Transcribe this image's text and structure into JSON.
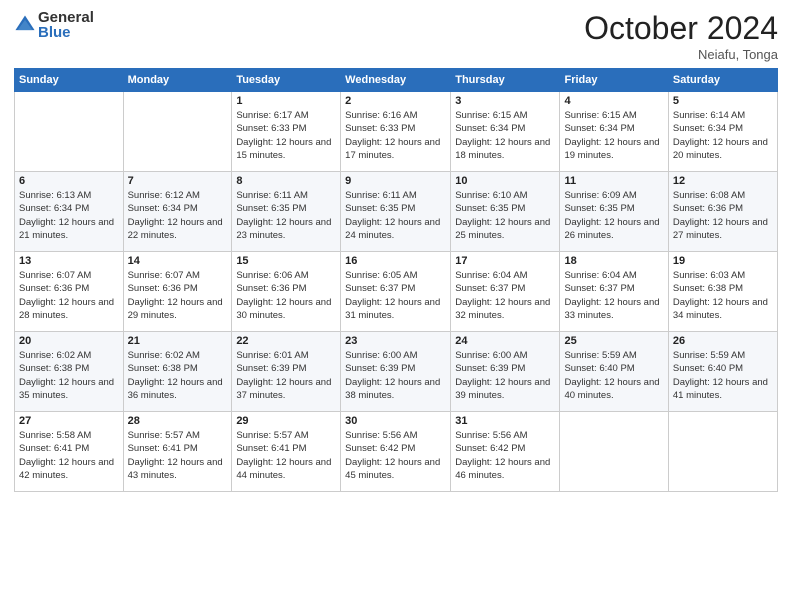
{
  "header": {
    "logo_general": "General",
    "logo_blue": "Blue",
    "month_title": "October 2024",
    "location": "Neiafu, Tonga"
  },
  "weekdays": [
    "Sunday",
    "Monday",
    "Tuesday",
    "Wednesday",
    "Thursday",
    "Friday",
    "Saturday"
  ],
  "weeks": [
    [
      {
        "day": "",
        "info": ""
      },
      {
        "day": "",
        "info": ""
      },
      {
        "day": "1",
        "info": "Sunrise: 6:17 AM\nSunset: 6:33 PM\nDaylight: 12 hours and 15 minutes."
      },
      {
        "day": "2",
        "info": "Sunrise: 6:16 AM\nSunset: 6:33 PM\nDaylight: 12 hours and 17 minutes."
      },
      {
        "day": "3",
        "info": "Sunrise: 6:15 AM\nSunset: 6:34 PM\nDaylight: 12 hours and 18 minutes."
      },
      {
        "day": "4",
        "info": "Sunrise: 6:15 AM\nSunset: 6:34 PM\nDaylight: 12 hours and 19 minutes."
      },
      {
        "day": "5",
        "info": "Sunrise: 6:14 AM\nSunset: 6:34 PM\nDaylight: 12 hours and 20 minutes."
      }
    ],
    [
      {
        "day": "6",
        "info": "Sunrise: 6:13 AM\nSunset: 6:34 PM\nDaylight: 12 hours and 21 minutes."
      },
      {
        "day": "7",
        "info": "Sunrise: 6:12 AM\nSunset: 6:34 PM\nDaylight: 12 hours and 22 minutes."
      },
      {
        "day": "8",
        "info": "Sunrise: 6:11 AM\nSunset: 6:35 PM\nDaylight: 12 hours and 23 minutes."
      },
      {
        "day": "9",
        "info": "Sunrise: 6:11 AM\nSunset: 6:35 PM\nDaylight: 12 hours and 24 minutes."
      },
      {
        "day": "10",
        "info": "Sunrise: 6:10 AM\nSunset: 6:35 PM\nDaylight: 12 hours and 25 minutes."
      },
      {
        "day": "11",
        "info": "Sunrise: 6:09 AM\nSunset: 6:35 PM\nDaylight: 12 hours and 26 minutes."
      },
      {
        "day": "12",
        "info": "Sunrise: 6:08 AM\nSunset: 6:36 PM\nDaylight: 12 hours and 27 minutes."
      }
    ],
    [
      {
        "day": "13",
        "info": "Sunrise: 6:07 AM\nSunset: 6:36 PM\nDaylight: 12 hours and 28 minutes."
      },
      {
        "day": "14",
        "info": "Sunrise: 6:07 AM\nSunset: 6:36 PM\nDaylight: 12 hours and 29 minutes."
      },
      {
        "day": "15",
        "info": "Sunrise: 6:06 AM\nSunset: 6:36 PM\nDaylight: 12 hours and 30 minutes."
      },
      {
        "day": "16",
        "info": "Sunrise: 6:05 AM\nSunset: 6:37 PM\nDaylight: 12 hours and 31 minutes."
      },
      {
        "day": "17",
        "info": "Sunrise: 6:04 AM\nSunset: 6:37 PM\nDaylight: 12 hours and 32 minutes."
      },
      {
        "day": "18",
        "info": "Sunrise: 6:04 AM\nSunset: 6:37 PM\nDaylight: 12 hours and 33 minutes."
      },
      {
        "day": "19",
        "info": "Sunrise: 6:03 AM\nSunset: 6:38 PM\nDaylight: 12 hours and 34 minutes."
      }
    ],
    [
      {
        "day": "20",
        "info": "Sunrise: 6:02 AM\nSunset: 6:38 PM\nDaylight: 12 hours and 35 minutes."
      },
      {
        "day": "21",
        "info": "Sunrise: 6:02 AM\nSunset: 6:38 PM\nDaylight: 12 hours and 36 minutes."
      },
      {
        "day": "22",
        "info": "Sunrise: 6:01 AM\nSunset: 6:39 PM\nDaylight: 12 hours and 37 minutes."
      },
      {
        "day": "23",
        "info": "Sunrise: 6:00 AM\nSunset: 6:39 PM\nDaylight: 12 hours and 38 minutes."
      },
      {
        "day": "24",
        "info": "Sunrise: 6:00 AM\nSunset: 6:39 PM\nDaylight: 12 hours and 39 minutes."
      },
      {
        "day": "25",
        "info": "Sunrise: 5:59 AM\nSunset: 6:40 PM\nDaylight: 12 hours and 40 minutes."
      },
      {
        "day": "26",
        "info": "Sunrise: 5:59 AM\nSunset: 6:40 PM\nDaylight: 12 hours and 41 minutes."
      }
    ],
    [
      {
        "day": "27",
        "info": "Sunrise: 5:58 AM\nSunset: 6:41 PM\nDaylight: 12 hours and 42 minutes."
      },
      {
        "day": "28",
        "info": "Sunrise: 5:57 AM\nSunset: 6:41 PM\nDaylight: 12 hours and 43 minutes."
      },
      {
        "day": "29",
        "info": "Sunrise: 5:57 AM\nSunset: 6:41 PM\nDaylight: 12 hours and 44 minutes."
      },
      {
        "day": "30",
        "info": "Sunrise: 5:56 AM\nSunset: 6:42 PM\nDaylight: 12 hours and 45 minutes."
      },
      {
        "day": "31",
        "info": "Sunrise: 5:56 AM\nSunset: 6:42 PM\nDaylight: 12 hours and 46 minutes."
      },
      {
        "day": "",
        "info": ""
      },
      {
        "day": "",
        "info": ""
      }
    ]
  ]
}
